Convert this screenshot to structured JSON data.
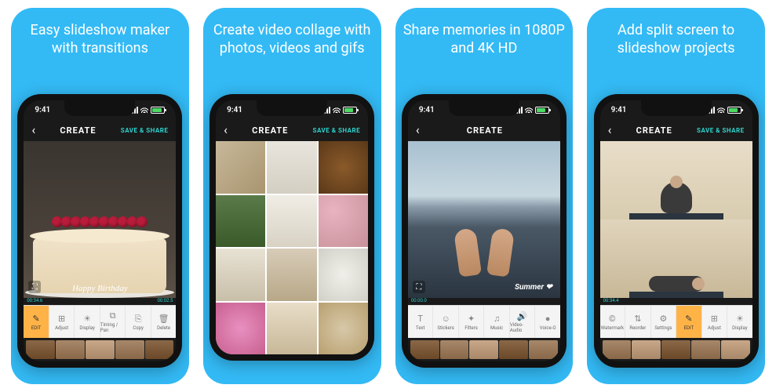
{
  "cards": [
    {
      "caption": "Easy slideshow maker with transitions",
      "statusTime": "9:41",
      "navTitle": "CREATE",
      "navAction": "SAVE & SHARE",
      "overlayText": "Happy Birthday",
      "timeStart": "00:34.6",
      "timeEnd": "00:02.5",
      "tools": [
        {
          "label": "EDIT",
          "icon": "✎"
        },
        {
          "label": "Adjust",
          "icon": "⊞"
        },
        {
          "label": "Display",
          "icon": "☀"
        },
        {
          "label": "Timing / Pan",
          "icon": "⧉"
        },
        {
          "label": "Copy",
          "icon": "⎘"
        },
        {
          "label": "Delete",
          "icon": "🗑"
        }
      ]
    },
    {
      "caption": "Create video collage with photos, videos and gifs",
      "statusTime": "9:41",
      "navTitle": "CREATE",
      "navAction": "SAVE & SHARE"
    },
    {
      "caption": "Share memories in 1080P and 4K HD",
      "statusTime": "9:41",
      "navTitle": "CREATE",
      "navAction": "",
      "summerLabel": "Summer ❤",
      "timeStart": "00:00.0",
      "tools": [
        {
          "label": "Text",
          "icon": "T"
        },
        {
          "label": "Stickers",
          "icon": "☺"
        },
        {
          "label": "Filters",
          "icon": "✦"
        },
        {
          "label": "Music",
          "icon": "♫"
        },
        {
          "label": "Video-Audio",
          "icon": "🔊"
        },
        {
          "label": "Voice-O",
          "icon": "●"
        }
      ]
    },
    {
      "caption": "Add split screen to slideshow projects",
      "statusTime": "9:41",
      "navTitle": "CREATE",
      "navAction": "SAVE & SHARE",
      "timeStart": "00:34.4",
      "tools": [
        {
          "label": "Watermark",
          "icon": "©"
        },
        {
          "label": "Reorder",
          "icon": "⇅"
        },
        {
          "label": "Settings",
          "icon": "⚙"
        },
        {
          "label": "EDIT",
          "icon": "✎"
        },
        {
          "label": "Adjust",
          "icon": "⊞"
        },
        {
          "label": "Display",
          "icon": "☀"
        }
      ]
    }
  ]
}
